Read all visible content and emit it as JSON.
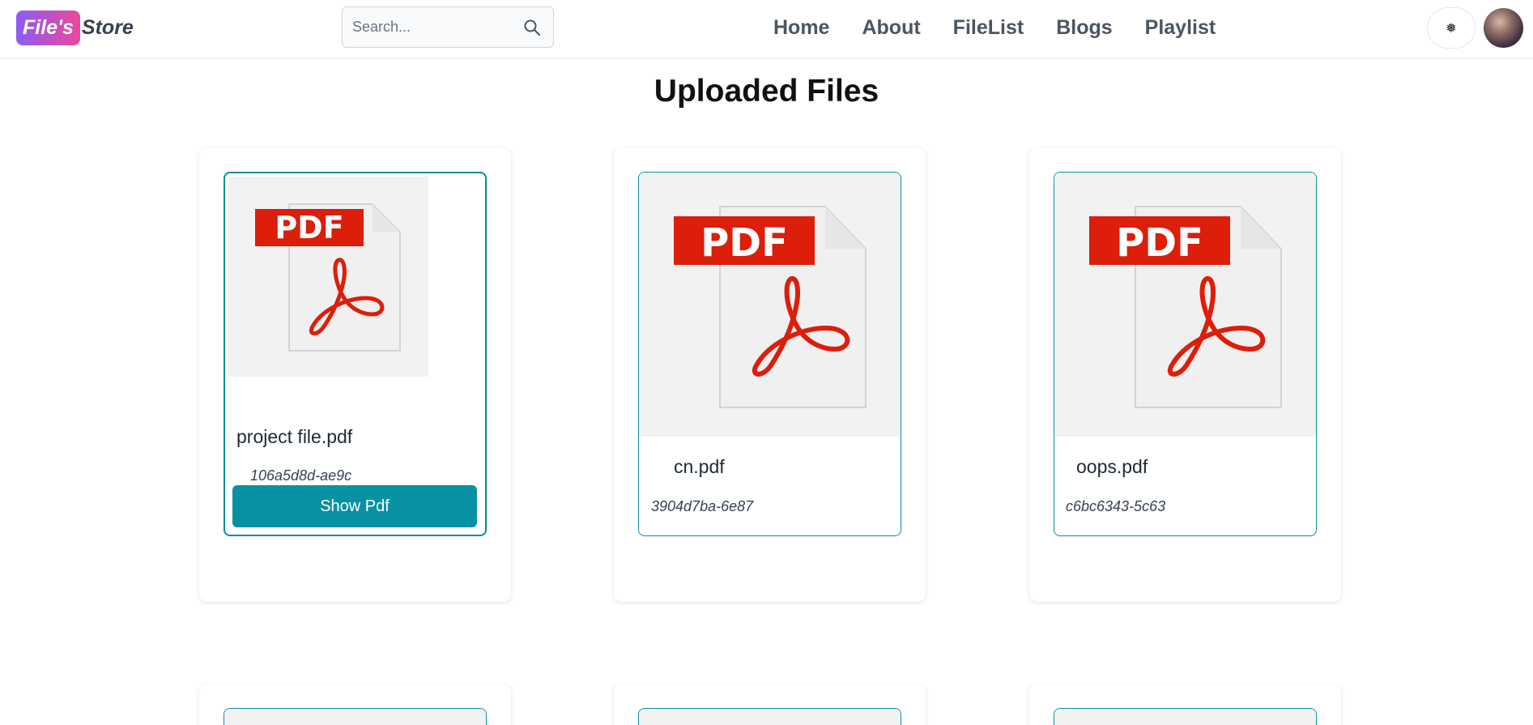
{
  "navbar": {
    "logo_badge": "File's",
    "logo_text": "Store",
    "search_placeholder": "Search...",
    "links": [
      "Home",
      "About",
      "FileList",
      "Blogs",
      "Playlist"
    ],
    "theme_icon": "❅"
  },
  "page_title": "Uploaded Files",
  "files": [
    {
      "name": "project file.pdf",
      "id": "106a5d8d-ae9c",
      "action": "Show Pdf"
    },
    {
      "name": "cn.pdf",
      "id": "3904d7ba-6e87"
    },
    {
      "name": "oops.pdf",
      "id": "c6bc6343-5c63"
    }
  ],
  "icons": {
    "search": "search-icon",
    "theme": "theme-toggle-icon",
    "file": "pdf-file-icon"
  },
  "colors": {
    "accent": "#0891a2",
    "pdf_red": "#dc1e0a",
    "logo_gradient_start": "#8b5cf6",
    "logo_gradient_end": "#ec4899"
  }
}
